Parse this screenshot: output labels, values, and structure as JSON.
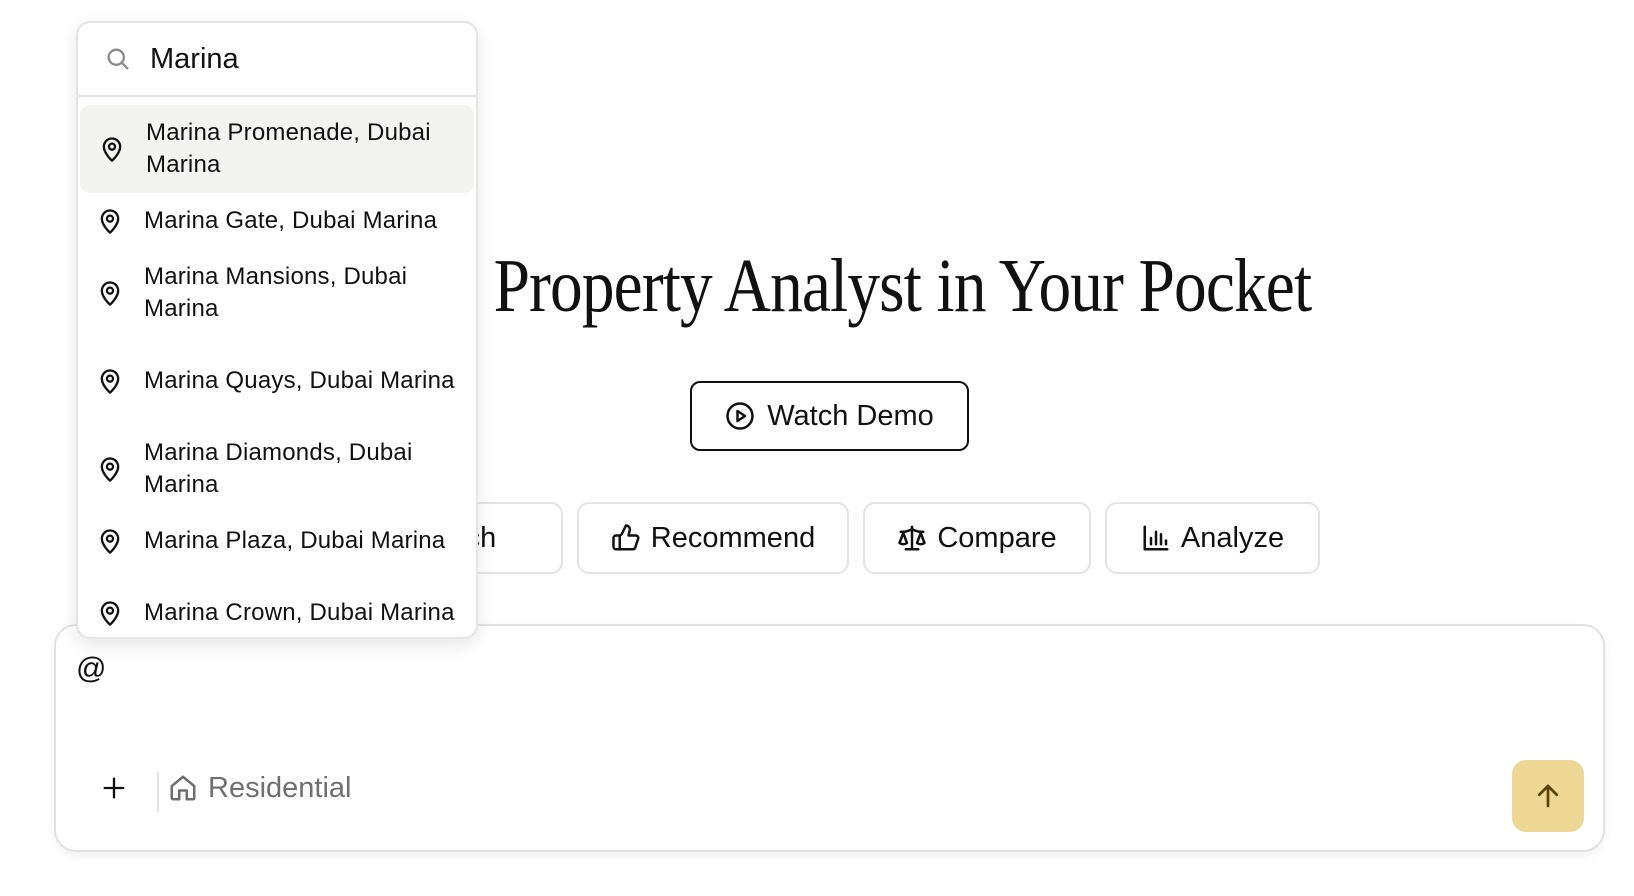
{
  "hero": {
    "title": "Dubai Property Analyst in Your Pocket"
  },
  "demo_button": {
    "label": "Watch Demo"
  },
  "actions": [
    {
      "label": "Pitch"
    },
    {
      "label": "Recommend"
    },
    {
      "label": "Compare"
    },
    {
      "label": "Analyze"
    }
  ],
  "composer": {
    "text": "@",
    "category": "Residential"
  },
  "location_search": {
    "query": "Marina",
    "suggestions": [
      "Marina Promenade, Dubai Marina",
      "Marina Gate, Dubai Marina",
      "Marina Mansions, Dubai Marina",
      "Marina Quays, Dubai Marina",
      "Marina Diamonds, Dubai Marina",
      "Marina Plaza, Dubai Marina",
      "Marina Crown, Dubai Marina"
    ]
  },
  "colors": {
    "send_button": "#efd896",
    "active_suggestion": "#f3f3f2",
    "text": "#111111",
    "muted_text": "#6f6f6f"
  }
}
